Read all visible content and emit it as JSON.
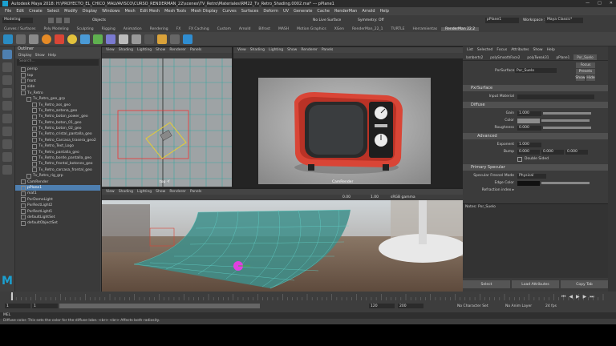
{
  "window": {
    "title": "Autodesk Maya 2018: H:\\PROYECTO_EL_CHICO_MALVAVISCO\\CURSO_RENDERMAN_22\\scenes\\TV_Retro\\Materiales\\RM22_Tv_Retro_Shading.0002.ma* --- pPlane1"
  },
  "menubar": [
    "File",
    "Edit",
    "Create",
    "Select",
    "Modify",
    "Display",
    "Windows",
    "Mesh",
    "Edit Mesh",
    "Mesh Tools",
    "Mesh Display",
    "Curves",
    "Surfaces",
    "Deform",
    "UV",
    "Generate",
    "Cache",
    "RenderMan",
    "Arnold",
    "Help"
  ],
  "statusline": {
    "mode": "Modeling",
    "objects": "Objects",
    "no_live_surface": "No Live Surface",
    "symmetry": "Symmetry: Off",
    "selection_field": "pPlane1",
    "workspace_label": "Workspace :",
    "workspace_value": "Maya Classic*"
  },
  "shelf_tabs": [
    "Curves / Surfaces",
    "Poly Modeling",
    "Sculpting",
    "Rigging",
    "Animation",
    "Rendering",
    "FX",
    "FX Caching",
    "Custom",
    "Arnold",
    "Bifrost",
    "MASH",
    "Motion Graphics",
    "XGen",
    "RenderMan_22_1",
    "TURTLE",
    "Herramientas",
    "RenderMan 22.2"
  ],
  "shelf_active": "RenderMan 22.2",
  "outliner": {
    "title": "Outliner",
    "menu": [
      "Display",
      "Show",
      "Help"
    ],
    "search_placeholder": "Search...",
    "items": [
      {
        "label": "persp",
        "indent": 1
      },
      {
        "label": "top",
        "indent": 1
      },
      {
        "label": "front",
        "indent": 1
      },
      {
        "label": "side",
        "indent": 1
      },
      {
        "label": "Tv_Retro",
        "indent": 1
      },
      {
        "label": "Tv_Retro_geo_grp",
        "indent": 2
      },
      {
        "label": "Tv_Retro_ass_geo",
        "indent": 3
      },
      {
        "label": "Tv_Retro_antena_geo",
        "indent": 3
      },
      {
        "label": "Tv_Retro_boton_power_geo",
        "indent": 3
      },
      {
        "label": "Tv_Retro_boton_01_geo",
        "indent": 3
      },
      {
        "label": "Tv_Retro_boton_02_geo",
        "indent": 3
      },
      {
        "label": "Tv_Retro_cristal_pantalla_geo",
        "indent": 3
      },
      {
        "label": "Tv_Retro_Carcasa_trasera_geo2",
        "indent": 3
      },
      {
        "label": "Tv_Retro_Text_Logo",
        "indent": 3
      },
      {
        "label": "Tv_Retro_pantalla_geo",
        "indent": 3
      },
      {
        "label": "Tv_Retro_borde_pantalla_geo",
        "indent": 3
      },
      {
        "label": "Tv_Retro_frontal_botones_geo",
        "indent": 3
      },
      {
        "label": "Tv_Retro_carcasa_frontal_geo",
        "indent": 3
      },
      {
        "label": "Tv_Retro_rig_grp",
        "indent": 2
      },
      {
        "label": "CamRender",
        "indent": 1
      },
      {
        "label": "pPlane1",
        "indent": 1,
        "selected": true
      },
      {
        "label": "mat1",
        "indent": 1
      },
      {
        "label": "PxrDomeLight",
        "indent": 1
      },
      {
        "label": "PxrRectLight2",
        "indent": 1
      },
      {
        "label": "PxrRectLight1",
        "indent": 1
      },
      {
        "label": "defaultLightSet",
        "indent": 1
      },
      {
        "label": "defaultObjectSet",
        "indent": 1
      }
    ]
  },
  "viewport_menu": [
    "View",
    "Shading",
    "Lighting",
    "Show",
    "Renderer",
    "Panels"
  ],
  "viewports": {
    "top_left_label": "top -Y",
    "top_right_camera": "CamRender",
    "bottom_exposure": "0.00",
    "bottom_gamma": "1.00",
    "bottom_colorspace": "sRGB gamma"
  },
  "attribute_editor": {
    "menu": [
      "List",
      "Selected",
      "Focus",
      "Attributes",
      "Show",
      "Help"
    ],
    "tabs": [
      "lamberts2",
      "polySmoothFace2",
      "polyTweak31",
      "pPlane1",
      "Pxr_Suelo"
    ],
    "node_label": "PxrSurface:",
    "node_value": "Pxr_Suelo",
    "focus_btn": "Focus",
    "presets_btn": "Presets",
    "show_btn": "Show",
    "hide_btn": "Hide",
    "sections": {
      "pxr_surface": "PxrSurface",
      "input_material": "Input Material",
      "diffuse": "Diffuse",
      "gain_label": "Gain",
      "gain_value": "1.000",
      "color_label": "Color",
      "roughness_label": "Roughness",
      "roughness_value": "0.000",
      "advanced": "Advanced",
      "exponent_label": "Exponent",
      "exponent_value": "1.000",
      "bump_label": "Bump",
      "bump_values": [
        "0.000",
        "0.000",
        "0.000"
      ],
      "double_sided": "Double Sided",
      "primary_specular": "Primary Specular",
      "fresnel_label": "Specular Fresnel Mode",
      "fresnel_value": "Physical",
      "edge_color": "Edge Color",
      "refraction_index": "Refraction index ▸"
    },
    "notes_label": "Notes: Pxr_Suelo",
    "bottom_buttons": [
      "Select",
      "Load Attributes",
      "Copy Tab"
    ]
  },
  "timeline": {
    "start": "1",
    "end": "120",
    "current": "1",
    "range_start": "1",
    "range_end": "120",
    "anim_end": "200",
    "char_set": "No Character Set",
    "anim_layer": "No Anim Layer",
    "fps": "24 fps"
  },
  "command_line": {
    "mode": "MEL"
  },
  "help_line": "Diffuse color. This sets the color for the diffuse lobe. <br> <br> Affects both radiosity.",
  "colors": {
    "tv_red": "#d94536",
    "selection_blue": "#4e7fb0",
    "grid_teal": "#3fa5a0",
    "ui_dark": "#3a3a3a"
  }
}
